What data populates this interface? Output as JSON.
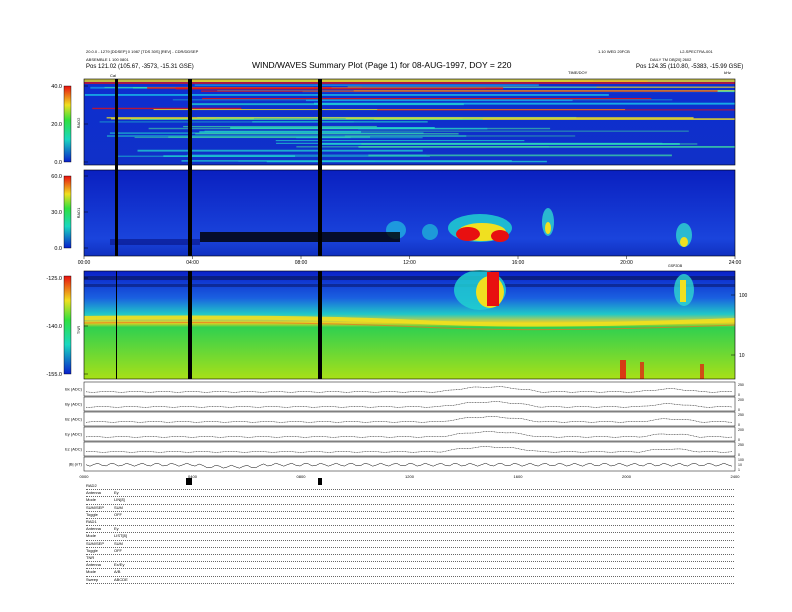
{
  "header": {
    "title": "WIND/WAVES Summary Plot (Page 1) for 08-AUG-1997, DOY = 220",
    "left_line1": "20.0.0 - 1279 [DDSEP] 0 1987 [TDS 30S] [REV] - CDR/DDSEP",
    "left_line2": "ABSEMBLE 1 100 0801",
    "left_pos_label": "Pos",
    "left_pos_value": "121.02 (105.67, -3573, -15.31 GSE)",
    "right_line1": "1.10 WED 20FCB",
    "right_line1b": "L2-SPECTRA-001",
    "right_line2": "DAILY TM DB[20] 2602",
    "right_pos_label": "Pos",
    "right_pos_value": "124.35 (110.80, -5383, -15.99 GSE)",
    "top_right_label": "TIME/DOY",
    "cal_label": "Cal",
    "units_label": "kHz"
  },
  "colors": {
    "cold": "#0a1fcc",
    "mid": "#1ad8c0",
    "warm": "#f0e020",
    "hot": "#e81010",
    "spine": "#000000"
  },
  "chart_data": [
    {
      "type": "heatmap",
      "name": "RAD2",
      "ylabel": "RAD2",
      "yticks": [
        "40.0",
        "20.0",
        "0.0"
      ],
      "ylim": [
        0,
        40
      ],
      "colorbar": true
    },
    {
      "type": "heatmap",
      "name": "RAD1",
      "ylabel": "RAD1",
      "yticks": [
        "60.0",
        "30.0",
        "0.0"
      ],
      "ylim": [
        0,
        60
      ],
      "colorbar": true,
      "xticks": [
        "00:00",
        "04:00",
        "08:00",
        "12:00",
        "16:00",
        "20:00",
        "24:00"
      ]
    },
    {
      "type": "heatmap",
      "name": "TNR",
      "ylabel": "TNR",
      "yticks": [
        "-125.0",
        "-140.0",
        "-155.0"
      ],
      "ylim": [
        -155,
        -125
      ],
      "right_ticks": [
        "100",
        "10"
      ],
      "right_label": "GSP2DB",
      "colorbar": true
    },
    {
      "type": "line",
      "name": "Bx",
      "ylabel": "Bx (ADC)",
      "right_ticks": [
        "250",
        "0"
      ]
    },
    {
      "type": "line",
      "name": "By",
      "ylabel": "By (ADC)",
      "right_ticks": [
        "200",
        "0"
      ]
    },
    {
      "type": "line",
      "name": "Bz",
      "ylabel": "Bz (ADC)",
      "right_ticks": [
        "250",
        "0"
      ]
    },
    {
      "type": "line",
      "name": "Ey",
      "ylabel": "Ey (ADC)",
      "right_ticks": [
        "200",
        "0"
      ]
    },
    {
      "type": "line",
      "name": "Ez",
      "ylabel": "Ez (ADC)",
      "right_ticks": [
        "250",
        "0"
      ]
    },
    {
      "type": "line",
      "name": "|B|",
      "ylabel": "|B| (nT)",
      "right_ticks": [
        "100",
        "10",
        "1"
      ],
      "xticks": [
        "0000",
        "0400",
        "0800",
        "1200",
        "1600",
        "2000",
        "2400"
      ]
    }
  ],
  "modes": [
    {
      "label": "RAD2",
      "value": ""
    },
    {
      "label": "Antenna",
      "value": "Ey"
    },
    {
      "label": "Mode",
      "value": "LIN[8]"
    },
    {
      "label": "SUM/SEP",
      "value": "SUM"
    },
    {
      "label": "Toggle",
      "value": "OFF"
    },
    {
      "label": "RAD1",
      "value": ""
    },
    {
      "label": "Antenna",
      "value": "Ey"
    },
    {
      "label": "Mode",
      "value": "LIST[8]"
    },
    {
      "label": "SUM/SEP",
      "value": "SUM"
    },
    {
      "label": "Toggle",
      "value": "OFF"
    },
    {
      "label": "TNR",
      "value": ""
    },
    {
      "label": "Antenna",
      "value": "Ex/Ey"
    },
    {
      "label": "Mode",
      "value": "A/B"
    },
    {
      "label": "Sweep",
      "value": "ABCDE"
    }
  ]
}
